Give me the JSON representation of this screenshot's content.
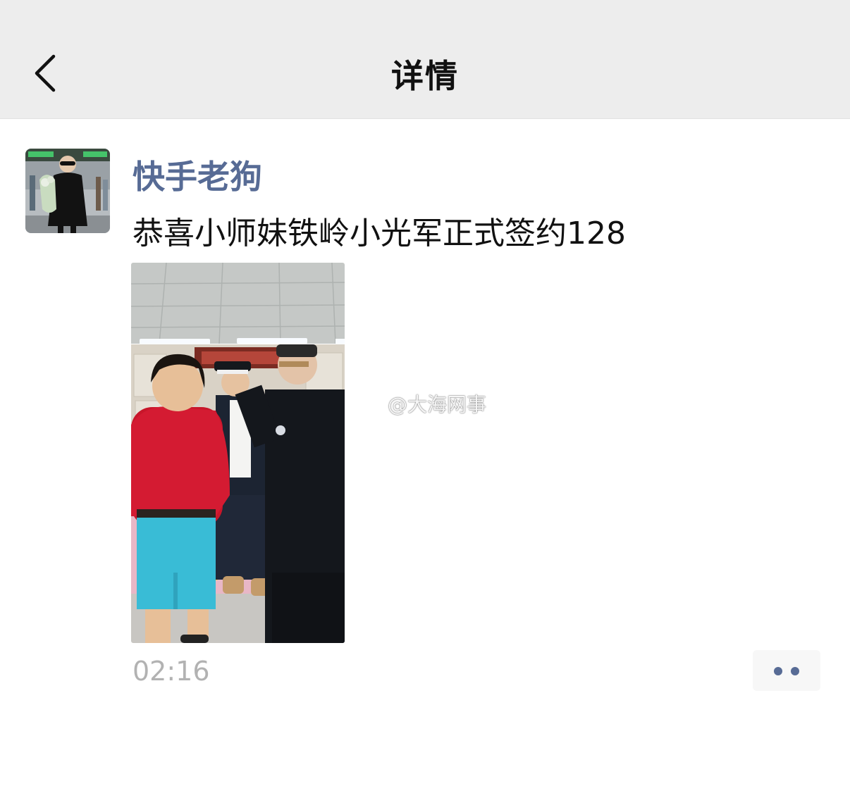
{
  "header": {
    "title": "详情",
    "back_icon": "chevron-left-icon"
  },
  "post": {
    "author": "快手老狗",
    "text": "恭喜小师妹铁岭小光军正式签约128",
    "time": "02:16",
    "watermark": "@大海网事",
    "more_icon": "ellipsis-icon"
  },
  "colors": {
    "header_bg": "#ededed",
    "author_link": "#576b95",
    "timestamp": "#b2b2b2"
  }
}
